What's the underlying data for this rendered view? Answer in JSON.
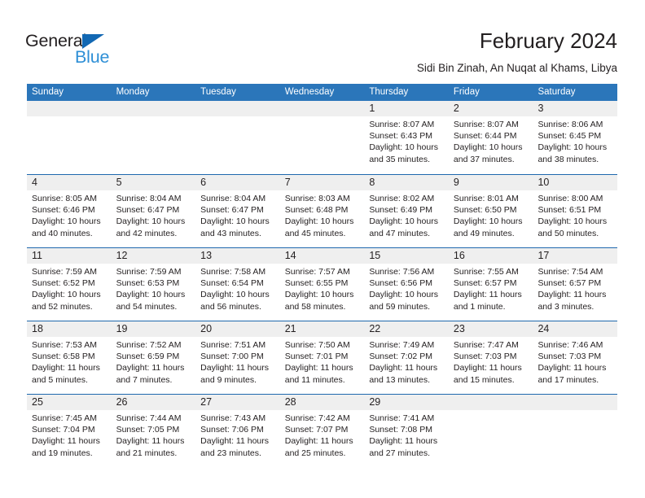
{
  "brand": {
    "name_part1": "General",
    "name_part2": "Blue",
    "triangle_icon": "triangle-icon",
    "accent_color": "#1268b3",
    "accent_color_light": "#2e8fd6"
  },
  "header": {
    "month_title": "February 2024",
    "location": "Sidi Bin Zinah, An Nuqat al Khams, Libya"
  },
  "theme": {
    "header_blue": "#2b76ba",
    "row_divider_blue": "#1f68ae",
    "day_band_gray": "#efefef",
    "text_color": "#231f20"
  },
  "weekdays": [
    "Sunday",
    "Monday",
    "Tuesday",
    "Wednesday",
    "Thursday",
    "Friday",
    "Saturday"
  ],
  "calendar": {
    "weeks": [
      [
        {
          "day": "",
          "sunrise": "",
          "sunset": "",
          "daylight_line1": "",
          "daylight_line2": ""
        },
        {
          "day": "",
          "sunrise": "",
          "sunset": "",
          "daylight_line1": "",
          "daylight_line2": ""
        },
        {
          "day": "",
          "sunrise": "",
          "sunset": "",
          "daylight_line1": "",
          "daylight_line2": ""
        },
        {
          "day": "",
          "sunrise": "",
          "sunset": "",
          "daylight_line1": "",
          "daylight_line2": ""
        },
        {
          "day": "1",
          "sunrise": "Sunrise: 8:07 AM",
          "sunset": "Sunset: 6:43 PM",
          "daylight_line1": "Daylight: 10 hours",
          "daylight_line2": "and 35 minutes."
        },
        {
          "day": "2",
          "sunrise": "Sunrise: 8:07 AM",
          "sunset": "Sunset: 6:44 PM",
          "daylight_line1": "Daylight: 10 hours",
          "daylight_line2": "and 37 minutes."
        },
        {
          "day": "3",
          "sunrise": "Sunrise: 8:06 AM",
          "sunset": "Sunset: 6:45 PM",
          "daylight_line1": "Daylight: 10 hours",
          "daylight_line2": "and 38 minutes."
        }
      ],
      [
        {
          "day": "4",
          "sunrise": "Sunrise: 8:05 AM",
          "sunset": "Sunset: 6:46 PM",
          "daylight_line1": "Daylight: 10 hours",
          "daylight_line2": "and 40 minutes."
        },
        {
          "day": "5",
          "sunrise": "Sunrise: 8:04 AM",
          "sunset": "Sunset: 6:47 PM",
          "daylight_line1": "Daylight: 10 hours",
          "daylight_line2": "and 42 minutes."
        },
        {
          "day": "6",
          "sunrise": "Sunrise: 8:04 AM",
          "sunset": "Sunset: 6:47 PM",
          "daylight_line1": "Daylight: 10 hours",
          "daylight_line2": "and 43 minutes."
        },
        {
          "day": "7",
          "sunrise": "Sunrise: 8:03 AM",
          "sunset": "Sunset: 6:48 PM",
          "daylight_line1": "Daylight: 10 hours",
          "daylight_line2": "and 45 minutes."
        },
        {
          "day": "8",
          "sunrise": "Sunrise: 8:02 AM",
          "sunset": "Sunset: 6:49 PM",
          "daylight_line1": "Daylight: 10 hours",
          "daylight_line2": "and 47 minutes."
        },
        {
          "day": "9",
          "sunrise": "Sunrise: 8:01 AM",
          "sunset": "Sunset: 6:50 PM",
          "daylight_line1": "Daylight: 10 hours",
          "daylight_line2": "and 49 minutes."
        },
        {
          "day": "10",
          "sunrise": "Sunrise: 8:00 AM",
          "sunset": "Sunset: 6:51 PM",
          "daylight_line1": "Daylight: 10 hours",
          "daylight_line2": "and 50 minutes."
        }
      ],
      [
        {
          "day": "11",
          "sunrise": "Sunrise: 7:59 AM",
          "sunset": "Sunset: 6:52 PM",
          "daylight_line1": "Daylight: 10 hours",
          "daylight_line2": "and 52 minutes."
        },
        {
          "day": "12",
          "sunrise": "Sunrise: 7:59 AM",
          "sunset": "Sunset: 6:53 PM",
          "daylight_line1": "Daylight: 10 hours",
          "daylight_line2": "and 54 minutes."
        },
        {
          "day": "13",
          "sunrise": "Sunrise: 7:58 AM",
          "sunset": "Sunset: 6:54 PM",
          "daylight_line1": "Daylight: 10 hours",
          "daylight_line2": "and 56 minutes."
        },
        {
          "day": "14",
          "sunrise": "Sunrise: 7:57 AM",
          "sunset": "Sunset: 6:55 PM",
          "daylight_line1": "Daylight: 10 hours",
          "daylight_line2": "and 58 minutes."
        },
        {
          "day": "15",
          "sunrise": "Sunrise: 7:56 AM",
          "sunset": "Sunset: 6:56 PM",
          "daylight_line1": "Daylight: 10 hours",
          "daylight_line2": "and 59 minutes."
        },
        {
          "day": "16",
          "sunrise": "Sunrise: 7:55 AM",
          "sunset": "Sunset: 6:57 PM",
          "daylight_line1": "Daylight: 11 hours",
          "daylight_line2": "and 1 minute."
        },
        {
          "day": "17",
          "sunrise": "Sunrise: 7:54 AM",
          "sunset": "Sunset: 6:57 PM",
          "daylight_line1": "Daylight: 11 hours",
          "daylight_line2": "and 3 minutes."
        }
      ],
      [
        {
          "day": "18",
          "sunrise": "Sunrise: 7:53 AM",
          "sunset": "Sunset: 6:58 PM",
          "daylight_line1": "Daylight: 11 hours",
          "daylight_line2": "and 5 minutes."
        },
        {
          "day": "19",
          "sunrise": "Sunrise: 7:52 AM",
          "sunset": "Sunset: 6:59 PM",
          "daylight_line1": "Daylight: 11 hours",
          "daylight_line2": "and 7 minutes."
        },
        {
          "day": "20",
          "sunrise": "Sunrise: 7:51 AM",
          "sunset": "Sunset: 7:00 PM",
          "daylight_line1": "Daylight: 11 hours",
          "daylight_line2": "and 9 minutes."
        },
        {
          "day": "21",
          "sunrise": "Sunrise: 7:50 AM",
          "sunset": "Sunset: 7:01 PM",
          "daylight_line1": "Daylight: 11 hours",
          "daylight_line2": "and 11 minutes."
        },
        {
          "day": "22",
          "sunrise": "Sunrise: 7:49 AM",
          "sunset": "Sunset: 7:02 PM",
          "daylight_line1": "Daylight: 11 hours",
          "daylight_line2": "and 13 minutes."
        },
        {
          "day": "23",
          "sunrise": "Sunrise: 7:47 AM",
          "sunset": "Sunset: 7:03 PM",
          "daylight_line1": "Daylight: 11 hours",
          "daylight_line2": "and 15 minutes."
        },
        {
          "day": "24",
          "sunrise": "Sunrise: 7:46 AM",
          "sunset": "Sunset: 7:03 PM",
          "daylight_line1": "Daylight: 11 hours",
          "daylight_line2": "and 17 minutes."
        }
      ],
      [
        {
          "day": "25",
          "sunrise": "Sunrise: 7:45 AM",
          "sunset": "Sunset: 7:04 PM",
          "daylight_line1": "Daylight: 11 hours",
          "daylight_line2": "and 19 minutes."
        },
        {
          "day": "26",
          "sunrise": "Sunrise: 7:44 AM",
          "sunset": "Sunset: 7:05 PM",
          "daylight_line1": "Daylight: 11 hours",
          "daylight_line2": "and 21 minutes."
        },
        {
          "day": "27",
          "sunrise": "Sunrise: 7:43 AM",
          "sunset": "Sunset: 7:06 PM",
          "daylight_line1": "Daylight: 11 hours",
          "daylight_line2": "and 23 minutes."
        },
        {
          "day": "28",
          "sunrise": "Sunrise: 7:42 AM",
          "sunset": "Sunset: 7:07 PM",
          "daylight_line1": "Daylight: 11 hours",
          "daylight_line2": "and 25 minutes."
        },
        {
          "day": "29",
          "sunrise": "Sunrise: 7:41 AM",
          "sunset": "Sunset: 7:08 PM",
          "daylight_line1": "Daylight: 11 hours",
          "daylight_line2": "and 27 minutes."
        },
        {
          "day": "",
          "sunrise": "",
          "sunset": "",
          "daylight_line1": "",
          "daylight_line2": ""
        },
        {
          "day": "",
          "sunrise": "",
          "sunset": "",
          "daylight_line1": "",
          "daylight_line2": ""
        }
      ]
    ]
  }
}
